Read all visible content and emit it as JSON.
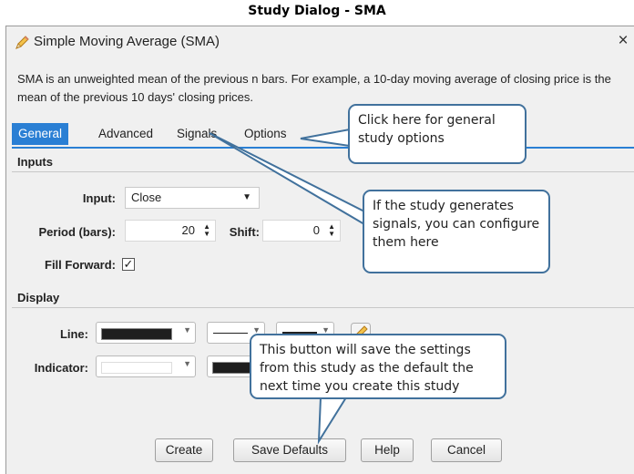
{
  "caption": "Study Dialog - SMA",
  "dialog": {
    "title": "Simple Moving Average (SMA)",
    "close_glyph": "×",
    "description": "SMA is an unweighted mean of the previous n bars. For example, a 10-day moving average of closing price is the mean of the previous 10 days' closing prices."
  },
  "tabs": [
    {
      "label": "General",
      "active": true
    },
    {
      "label": "Advanced",
      "active": false
    },
    {
      "label": "Signals",
      "active": false
    },
    {
      "label": "Options",
      "active": false
    }
  ],
  "inputs": {
    "heading": "Inputs",
    "input_label": "Input:",
    "input_value": "Close",
    "period_label": "Period (bars):",
    "period_value": "20",
    "shift_label": "Shift:",
    "shift_value": "0",
    "fill_forward_label": "Fill Forward:",
    "fill_forward_checked": true,
    "check_glyph": "✓"
  },
  "display": {
    "heading": "Display",
    "line_label": "Line:",
    "indicator_label": "Indicator:",
    "line_color": "#1e1e1e",
    "indicator_color": "#ffffff"
  },
  "buttons": {
    "create": "Create",
    "save_defaults": "Save Defaults",
    "help": "Help",
    "cancel": "Cancel"
  },
  "callouts": {
    "general": "Click here for general study options",
    "signals": "If the study generates signals, you can configure them here",
    "save_defaults": "This button will save the settings from this study as the default the next time you create this study"
  },
  "colors": {
    "accent": "#2a7fd4",
    "callout_border": "#41719c"
  },
  "icons": {
    "title": "pencil-icon",
    "close": "close-icon",
    "dropdown": "chevron-down-icon",
    "spinner": "spinner-arrows-icon",
    "edit": "pencil-icon"
  }
}
